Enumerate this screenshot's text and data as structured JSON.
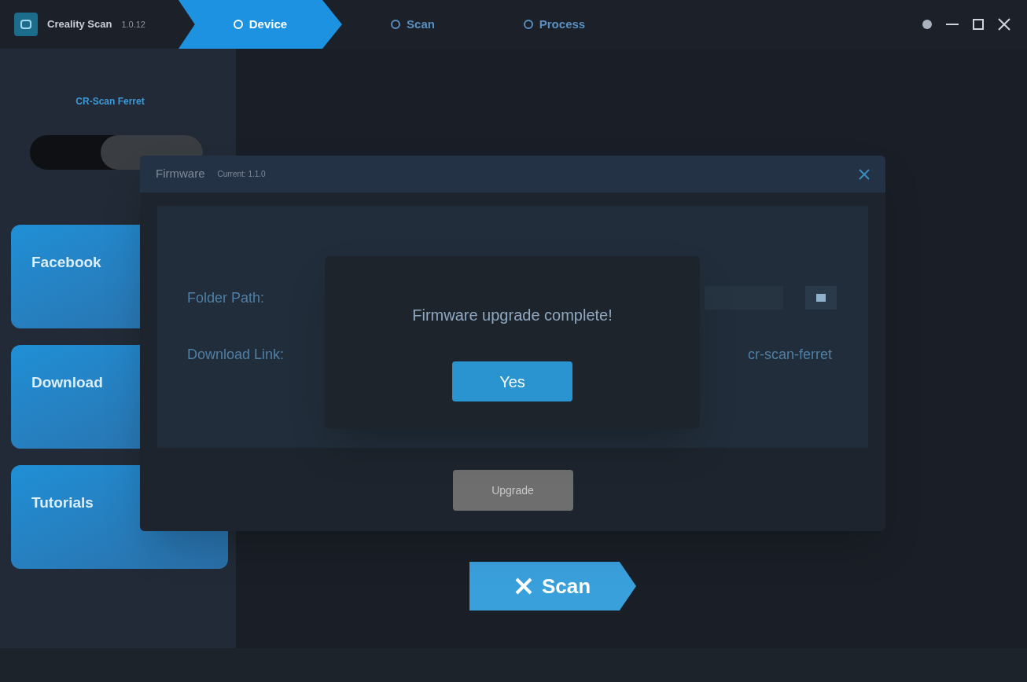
{
  "window": {
    "title": "Creality Scan",
    "version": "1.0.12"
  },
  "tabs": [
    {
      "label": "Device",
      "selected": true
    },
    {
      "label": "Scan",
      "selected": false
    },
    {
      "label": "Process",
      "selected": false
    }
  ],
  "sidebar": {
    "device_name": "CR-Scan Ferret",
    "cards": [
      {
        "title": "Facebook"
      },
      {
        "title": "Download"
      },
      {
        "title": "Tutorials"
      }
    ]
  },
  "firmware_dialog": {
    "title": "Firmware",
    "current": "Current: 1.1.0",
    "folder_label": "Folder Path:",
    "link_label": "Download Link:",
    "link_value": "cr-scan-ferret",
    "upgrade_button": "Upgrade"
  },
  "message": {
    "text": "Firmware upgrade complete!",
    "button": "Yes"
  },
  "scan_button": "Scan"
}
